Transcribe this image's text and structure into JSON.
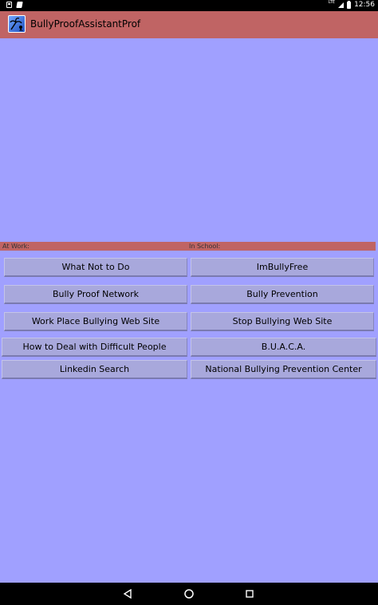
{
  "status_bar": {
    "network": "LTE",
    "time": "12:56"
  },
  "app": {
    "title": "BullyProofAssistantProf",
    "icon": "palm-tree-icon"
  },
  "sections": {
    "work_label": "At Work:",
    "school_label": "In School:"
  },
  "work_buttons": [
    "What Not to Do",
    "Bully Proof Network",
    "Work Place Bullying Web Site",
    "How to Deal with Difficult People",
    "Linkedin Search"
  ],
  "school_buttons": [
    "ImBullyFree",
    "Bully Prevention",
    "Stop Bullying Web Site",
    "B.U.A.C.A.",
    "National Bullying Prevention Center"
  ],
  "colors": {
    "background": "#a0a0ff",
    "accent": "#c06464",
    "button": "#a8a8dc"
  },
  "nav_icons": [
    "back-icon",
    "home-icon",
    "recents-icon"
  ]
}
